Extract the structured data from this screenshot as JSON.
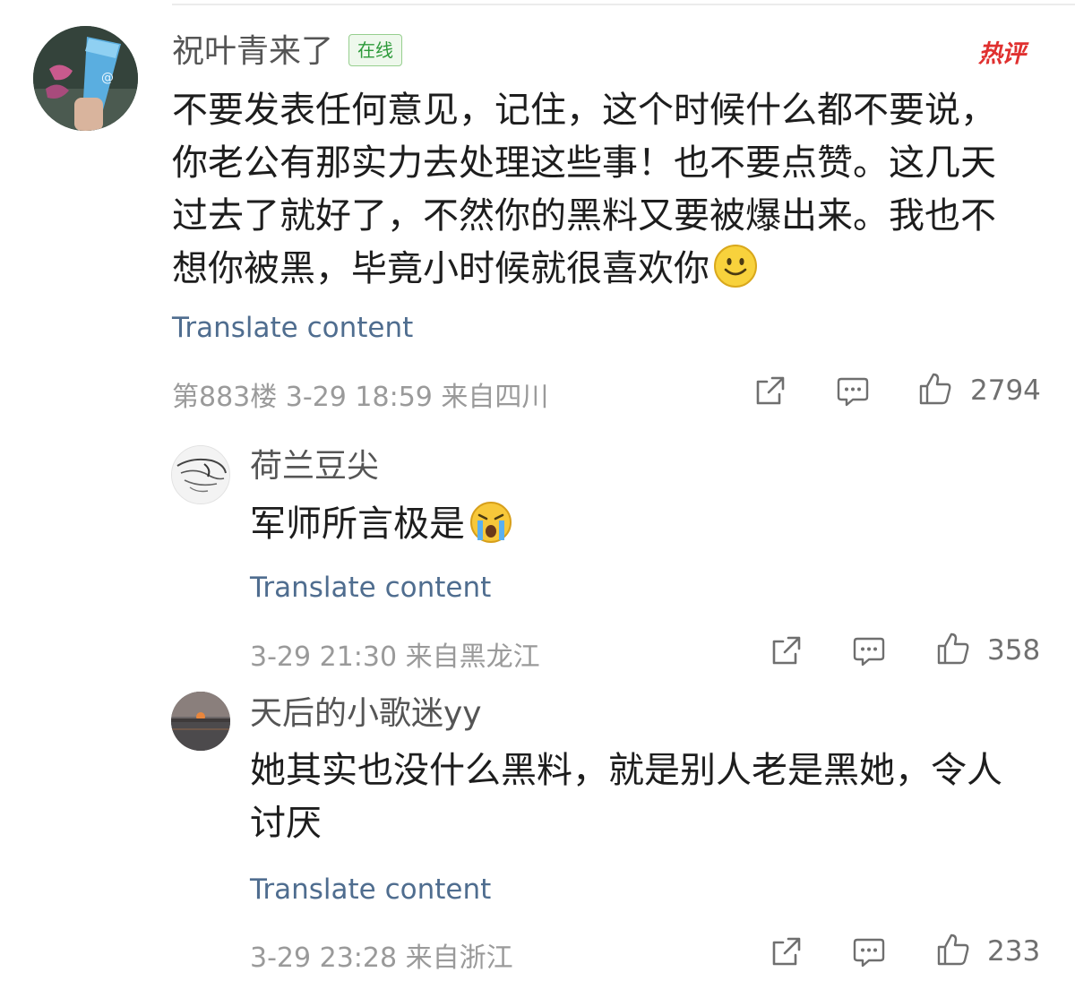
{
  "main_comment": {
    "username": "祝叶青来了",
    "online_badge": "在线",
    "hot_label": "热评",
    "content_lines": [
      "不要发表任何意见，记住，这个时候什么都不要说，",
      "你老公有那实力去处理这些事！也不要点赞。这几天",
      "过去了就好了，不然你的黑料又要被爆出来。我也不",
      "想你被黑，毕竟小时候就很喜欢你"
    ],
    "emoji_icon": "smile-emoji-icon",
    "translate_label": "Translate content",
    "meta": "第883楼 3-29 18:59 来自四川",
    "like_count": "2794"
  },
  "replies": [
    {
      "username": "荷兰豆尖",
      "content_lines": [
        "军师所言极是"
      ],
      "emoji_icon": "crying-emoji-icon",
      "translate_label": "Translate content",
      "meta": "3-29 21:30 来自黑龙江",
      "like_count": "358"
    },
    {
      "username": "天后的小歌迷yy",
      "content_lines": [
        "她其实也没什么黑料，就是别人老是黑她，令人",
        "讨厌"
      ],
      "translate_label": "Translate content",
      "meta": "3-29 23:28 来自浙江",
      "like_count": "233"
    }
  ],
  "icons": [
    "share-icon",
    "comment-icon",
    "like-icon"
  ],
  "colors": {
    "translate_link": "#4f6d8f",
    "meta_text": "#9a9a9a",
    "hot_label": "#e0302f",
    "online_badge": "#2d9a3a"
  }
}
